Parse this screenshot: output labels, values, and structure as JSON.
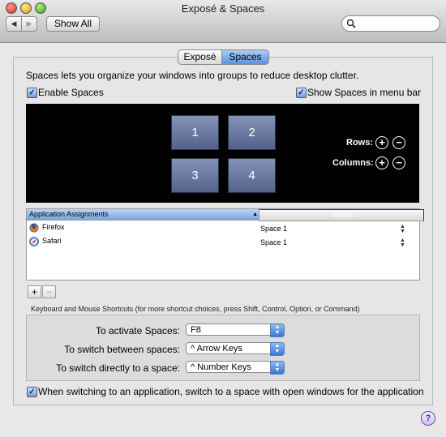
{
  "window": {
    "title": "Exposé & Spaces"
  },
  "toolbar": {
    "back_icon": "◀",
    "forward_icon": "▶",
    "show_all_label": "Show All",
    "search_icon": "magnifier"
  },
  "tabs": [
    {
      "label": "Exposé",
      "selected": false
    },
    {
      "label": "Spaces",
      "selected": true
    }
  ],
  "description": "Spaces lets you organize your windows into groups to reduce desktop clutter.",
  "enable_spaces": {
    "label": "Enable Spaces",
    "checked": true
  },
  "show_menu_bar": {
    "label": "Show Spaces in menu bar",
    "checked": true
  },
  "spaces": [
    "1",
    "2",
    "3",
    "4"
  ],
  "grid_controls": {
    "rows_label": "Rows:",
    "columns_label": "Columns:",
    "add": "+",
    "remove": "−"
  },
  "assignments": {
    "headers": {
      "app": "Application Assignments",
      "space": "Space",
      "sort_icon": "▲"
    },
    "rows": [
      {
        "app": "Firefox",
        "space": "Space 1"
      },
      {
        "app": "Safari",
        "space": "Space 1"
      }
    ],
    "add": "+",
    "remove": "−"
  },
  "shortcuts": {
    "header": "Keyboard and Mouse Shortcuts (for more shortcut choices, press Shift, Control, Option, or Command)",
    "activate": {
      "label": "To activate Spaces:",
      "value": "F8"
    },
    "switch_between": {
      "label": "To switch between spaces:",
      "value": "^ Arrow Keys"
    },
    "switch_directly": {
      "label": "To switch directly to a space:",
      "value": "^ Number Keys"
    }
  },
  "switch_option": {
    "label": "When switching to an application, switch to a space with open windows for the application",
    "checked": true
  },
  "help": "?",
  "colors": {
    "accent": "#5a92de",
    "preview_bg": "#000000"
  }
}
